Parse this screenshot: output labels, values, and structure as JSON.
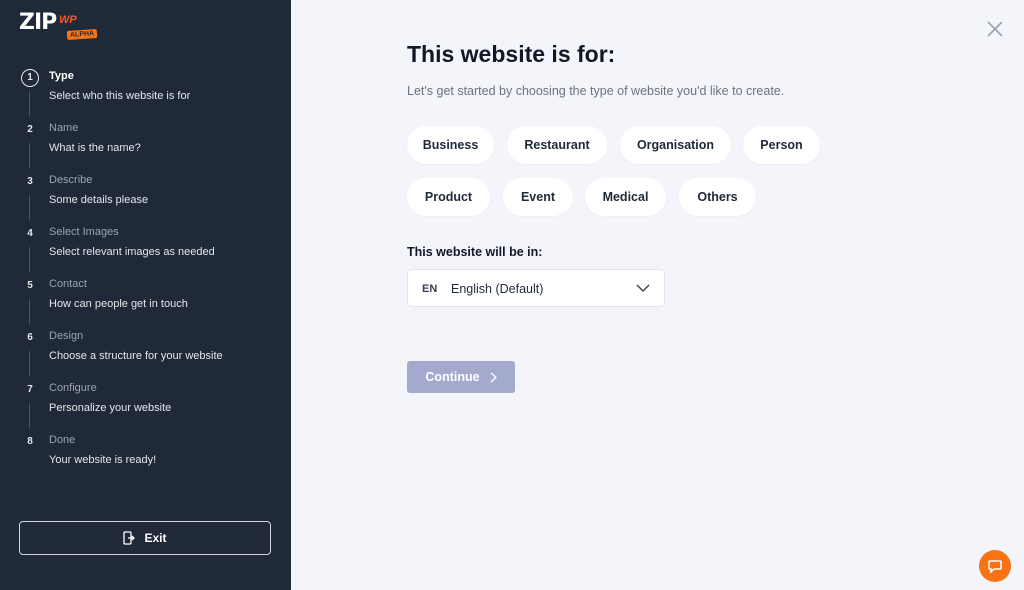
{
  "logo": {
    "text": "ZIP",
    "wp": "WP",
    "badge": "ALPHA"
  },
  "steps": [
    {
      "num": "1",
      "title": "Type",
      "desc": "Select who this website is for",
      "active": true
    },
    {
      "num": "2",
      "title": "Name",
      "desc": "What is the name?"
    },
    {
      "num": "3",
      "title": "Describe",
      "desc": "Some details please"
    },
    {
      "num": "4",
      "title": "Select Images",
      "desc": "Select relevant images as needed"
    },
    {
      "num": "5",
      "title": "Contact",
      "desc": "How can people get in touch"
    },
    {
      "num": "6",
      "title": "Design",
      "desc": "Choose a structure for your website"
    },
    {
      "num": "7",
      "title": "Configure",
      "desc": "Personalize your website"
    },
    {
      "num": "8",
      "title": "Done",
      "desc": "Your website is ready!"
    }
  ],
  "exit_label": "Exit",
  "main": {
    "title": "This website is for:",
    "subtitle": "Let's get started by choosing the type of website you'd like to create.",
    "types": [
      "Business",
      "Restaurant",
      "Organisation",
      "Person",
      "Product",
      "Event",
      "Medical",
      "Others"
    ],
    "language_label": "This website will be in:",
    "language_code": "EN",
    "language_name": "English (Default)",
    "continue_label": "Continue"
  },
  "colors": {
    "sidebar": "#1f2937",
    "accent": "#f97316",
    "button_disabled": "#a3aacd",
    "background": "#f3f5fb"
  }
}
